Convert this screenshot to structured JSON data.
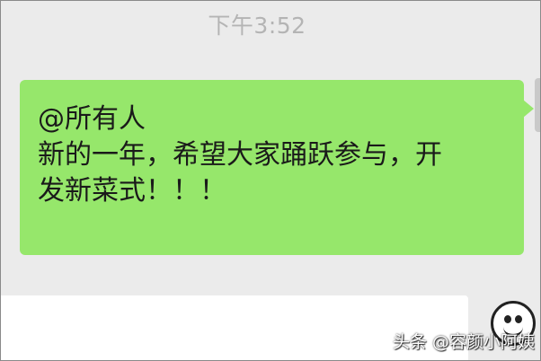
{
  "chat": {
    "timestamp": "下午3:52",
    "message": {
      "mention": "@所有人",
      "line1": "新的一年，希望大家踊跃参与，开",
      "line2": "发新菜式！！！",
      "bubble_color": "#96e76b"
    }
  },
  "input_bar": {
    "emoji_icon": "smiley-face-icon"
  },
  "watermark": "头条 @容颜小阿姨",
  "colors": {
    "background": "#ebebeb",
    "timestamp_text": "#b4b4b4",
    "message_text": "#1a1a1a"
  }
}
